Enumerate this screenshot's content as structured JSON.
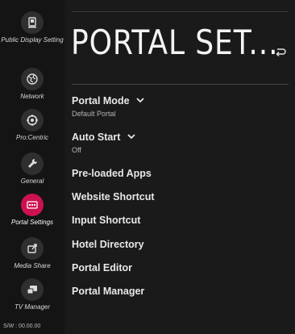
{
  "sidebar": {
    "items": [
      {
        "label": "Public Display Setting",
        "icon": "display-setting-icon"
      },
      {
        "label": "Network",
        "icon": "network-globe-icon"
      },
      {
        "label": "Pro:Centric",
        "icon": "procentric-icon"
      },
      {
        "label": "General",
        "icon": "wrench-icon"
      },
      {
        "label": "Portal Settings",
        "icon": "portal-icon",
        "active": true
      },
      {
        "label": "Media Share",
        "icon": "media-share-icon"
      },
      {
        "label": "TV Manager",
        "icon": "tv-manager-icon"
      }
    ],
    "version": "S/W : 00.00.00"
  },
  "header": {
    "title": "PORTAL SET..."
  },
  "menu": [
    {
      "label": "Portal Mode",
      "value": "Default Portal"
    },
    {
      "label": "Auto Start",
      "value": "Off"
    },
    {
      "label": "Pre-loaded Apps"
    },
    {
      "label": "Website Shortcut"
    },
    {
      "label": "Input Shortcut"
    },
    {
      "label": "Hotel Directory"
    },
    {
      "label": "Portal Editor"
    },
    {
      "label": "Portal Manager"
    }
  ],
  "colors": {
    "accent": "#cc1150",
    "background": "#1a1a1a",
    "sidebar": "#141414"
  }
}
